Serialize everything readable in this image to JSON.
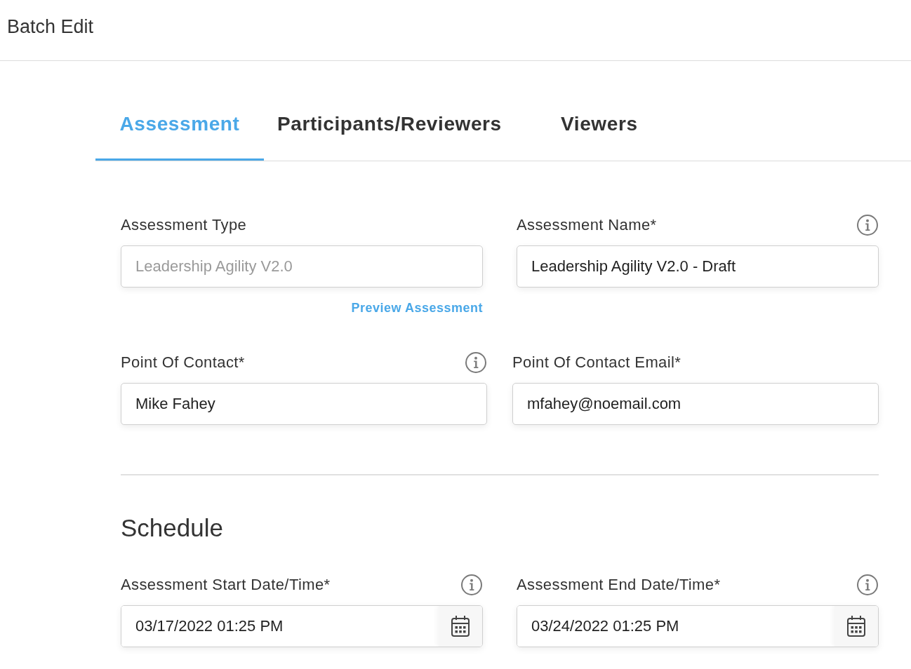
{
  "page_title": "Batch Edit",
  "tabs": [
    {
      "label": "Assessment",
      "selected": true
    },
    {
      "label": "Participants/Reviewers",
      "selected": false
    },
    {
      "label": "Viewers",
      "selected": false
    }
  ],
  "details": {
    "rows": [
      {
        "fields": [
          {
            "kind": "text",
            "label": "Assessment Type",
            "value": "Leadership Agility V2.0",
            "disabled": true,
            "info": false,
            "link": "Preview Assessment"
          },
          {
            "kind": "text",
            "label": "Assessment Name*",
            "value": "Leadership Agility V2.0 - Draft",
            "disabled": false,
            "info": true
          }
        ]
      },
      {
        "fields": [
          {
            "kind": "text",
            "label": "Point Of Contact*",
            "value": "Mike Fahey",
            "disabled": false,
            "info": true
          },
          {
            "kind": "text",
            "label": "Point Of Contact Email*",
            "value": "mfahey@noemail.com",
            "disabled": false,
            "info": false
          }
        ]
      }
    ]
  },
  "schedule": {
    "title": "Schedule",
    "fields": [
      {
        "kind": "date",
        "label": "Assessment Start Date/Time*",
        "value": "03/17/2022 01:25 PM",
        "disabled": false,
        "info": true
      },
      {
        "kind": "date",
        "label": "Assessment End Date/Time*",
        "value": "03/24/2022 01:25 PM",
        "disabled": false,
        "info": true
      }
    ]
  }
}
